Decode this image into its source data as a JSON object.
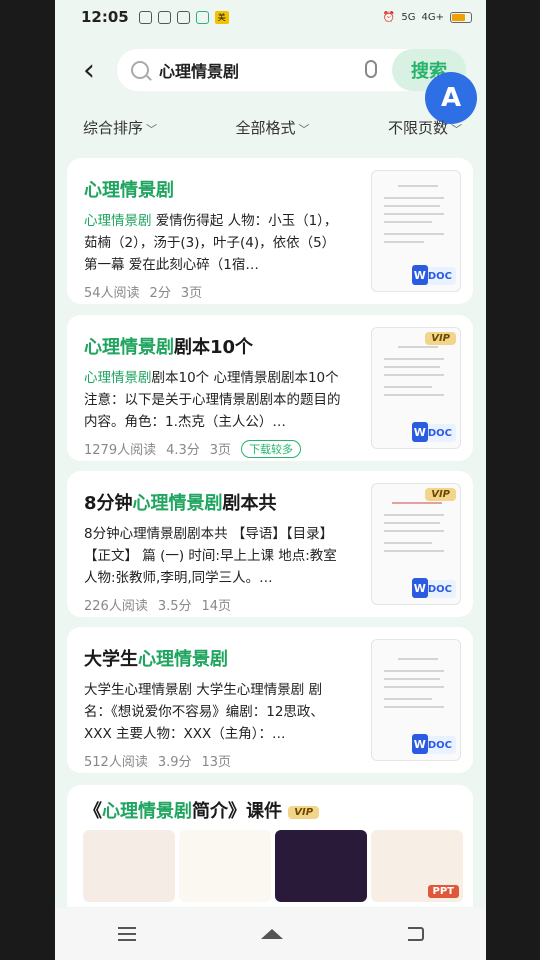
{
  "status": {
    "time": "12:05",
    "network": "4G+",
    "signal": "5G"
  },
  "search": {
    "query": "心理情景剧",
    "button": "搜索"
  },
  "filters": [
    "综合排序",
    "全部格式",
    "不限页数"
  ],
  "results": [
    {
      "title_pre": "",
      "title_hl": "心理情景剧",
      "title_post": "",
      "snippet_hl": "心理情景剧",
      "snippet": " 爱情伤得起 人物：小玉（1），茹楠（2），汤于(3)，叶子(4)，依依（5）第一幕 爱在此刻心碎（1宿…",
      "reads": "54人阅读",
      "score": "2分",
      "pages": "3页",
      "badge": "",
      "vip": false,
      "format": "DOC"
    },
    {
      "title_pre": "",
      "title_hl": "心理情景剧",
      "title_post": "剧本10个",
      "snippet_hl": "心理情景剧",
      "snippet": "剧本10个 心理情景剧剧本10个 注意：以下是关于心理情景剧剧本的题目的内容。角色：1.杰克（主人公）…",
      "reads": "1279人阅读",
      "score": "4.3分",
      "pages": "3页",
      "badge": "下载较多",
      "vip": true,
      "format": "DOC"
    },
    {
      "title_pre": "8分钟",
      "title_hl": "心理情景剧",
      "title_post": "剧本共",
      "snippet_hl": "",
      "snippet": "8分钟心理情景剧剧本共 【导语】【目录】【正文】 篇 (一) 时间:早上上课 地点:教室 人物:张教师,李明,同学三人。…",
      "reads": "226人阅读",
      "score": "3.5分",
      "pages": "14页",
      "badge": "",
      "vip": true,
      "format": "DOC"
    },
    {
      "title_pre": "大学生",
      "title_hl": "心理情景剧",
      "title_post": "",
      "snippet_hl": "",
      "snippet": "大学生心理情景剧 大学生心理情景剧 剧名：《想说爱你不容易》编剧：12思政、XXX 主要人物：XXX（主角）：…",
      "reads": "512人阅读",
      "score": "3.9分",
      "pages": "13页",
      "badge": "",
      "vip": false,
      "format": "DOC"
    }
  ],
  "ppt_card": {
    "title_pre": "《",
    "title_hl": "心理情景剧",
    "title_post": "简介》课件",
    "vip": "VIP",
    "format": "PPT"
  },
  "vip_label": "VIP"
}
